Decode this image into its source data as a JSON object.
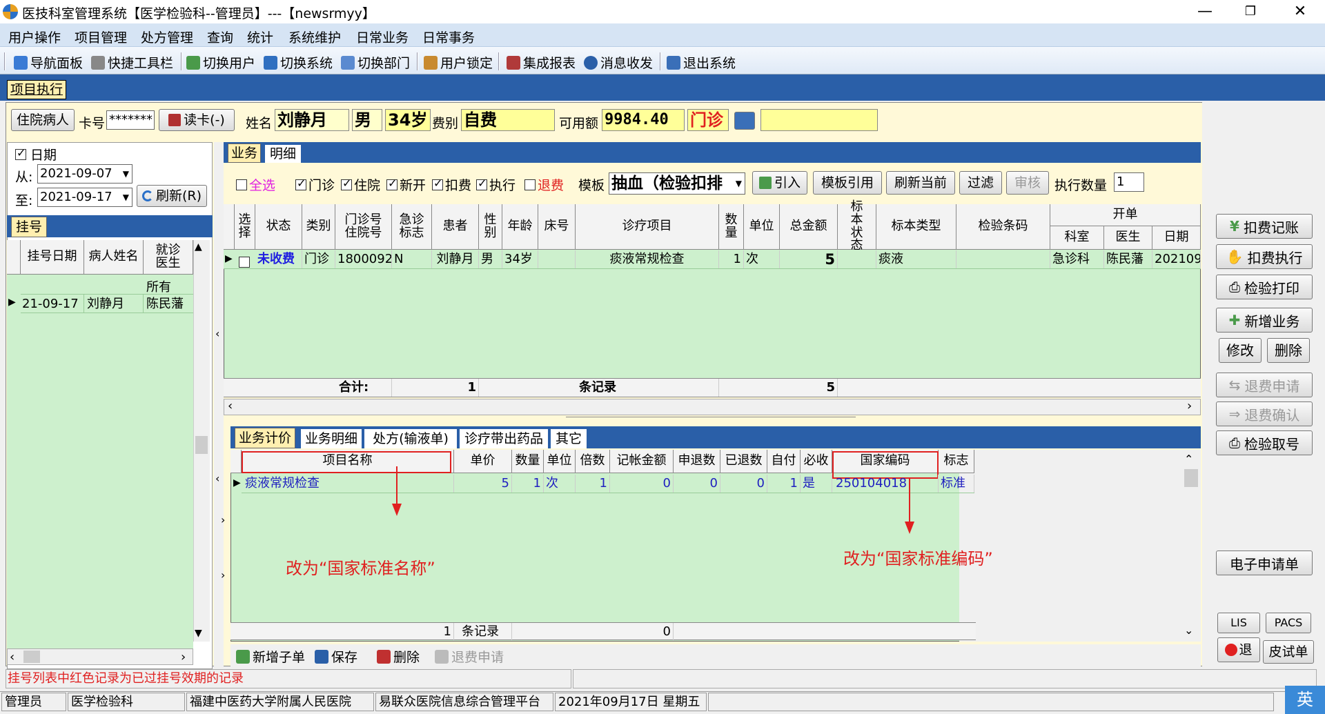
{
  "window": {
    "title": "医技科室管理系统【医学检验科--管理员】---【newsrmyy】",
    "min": "—",
    "restore": "❐",
    "close": "✕"
  },
  "menu": [
    "用户操作",
    "项目管理",
    "处方管理",
    "查询",
    "统计",
    "系统维护",
    "日常业务",
    "日常事务"
  ],
  "toolbar": [
    {
      "label": "导航面板",
      "icon": "dashboard-icon"
    },
    {
      "label": "快捷工具栏",
      "icon": "tools-icon"
    },
    {
      "label": "切换用户",
      "icon": "switch-user-icon"
    },
    {
      "label": "切换系统",
      "icon": "switch-system-icon"
    },
    {
      "label": "切换部门",
      "icon": "switch-dept-icon"
    },
    {
      "label": "用户锁定",
      "icon": "lock-user-icon"
    },
    {
      "label": "集成报表",
      "icon": "report-icon"
    },
    {
      "label": "消息收发",
      "icon": "message-icon"
    },
    {
      "label": "退出系统",
      "icon": "exit-icon"
    }
  ],
  "doc_tab": "项目执行",
  "patient": {
    "inpatient_btn": "住院病人",
    "card_label": "卡号",
    "card_value": "*******",
    "read_card_btn": "读卡(-)",
    "name_label": "姓名",
    "name": "刘静月",
    "sex": "男",
    "age": "34岁",
    "fee_label": "费别",
    "fee": "自费",
    "balance_label": "可用额",
    "balance": "9984.40",
    "visit_type": "门诊"
  },
  "left": {
    "date_label": "日期",
    "from_label": "从:",
    "from": "2021-09-07",
    "to_label": "至:",
    "to": "2021-09-17",
    "refresh_btn": "刷新(R)",
    "reg_tab": "挂号",
    "cols": [
      "挂号日期",
      "病人姓名",
      "就诊医生"
    ],
    "all_label": "所有",
    "rows": [
      {
        "date": "21-09-17",
        "name": "刘静月",
        "doctor": "陈民藩"
      }
    ]
  },
  "biz": {
    "tabs": [
      "业务",
      "明细"
    ],
    "filters": [
      {
        "label": "全选",
        "checked": false,
        "color": "#e020e0"
      },
      {
        "label": "门诊",
        "checked": true
      },
      {
        "label": "住院",
        "checked": true
      },
      {
        "label": "新开",
        "checked": true
      },
      {
        "label": "扣费",
        "checked": true
      },
      {
        "label": "执行",
        "checked": true
      },
      {
        "label": "退费",
        "checked": false,
        "color": "#e02020"
      }
    ],
    "template_label": "模板",
    "template_value": "抽血（检验扣排",
    "buttons": [
      "引入",
      "模板引用",
      "刷新当前",
      "过滤",
      "审核"
    ],
    "exec_qty_label": "执行数量",
    "exec_qty": "1",
    "cols": [
      "选择",
      "状态",
      "类别",
      "门诊号住院号",
      "急诊标志",
      "患者",
      "性别",
      "年龄",
      "床号",
      "诊疗项目",
      "数量",
      "单位",
      "总金额",
      "标本状态",
      "标本类型",
      "检验条码"
    ],
    "group_label": "开单",
    "group_cols": [
      "科室",
      "医生",
      "日期"
    ],
    "row": {
      "status": "未收费",
      "category": "门诊",
      "visit_no": "1800092",
      "emergency": "N",
      "patient": "刘静月",
      "sex": "男",
      "age": "34岁",
      "bed": "",
      "item": "痰液常规检查",
      "qty": "1",
      "unit": "次",
      "total": "5",
      "sample_status": "",
      "sample_type": "痰液",
      "barcode": "",
      "dept": "急诊科",
      "doctor": "陈民藩",
      "date": "202109"
    },
    "footer": {
      "sum_label": "合计:",
      "count": "1",
      "records_label": "条记录",
      "total": "5"
    }
  },
  "detail": {
    "tabs": [
      "业务计价",
      "业务明细",
      "处方(输液单)",
      "诊疗带出药品",
      "其它"
    ],
    "cols": [
      "项目名称",
      "单价",
      "数量",
      "单位",
      "倍数",
      "记帐金额",
      "申退数",
      "已退数",
      "自付",
      "必收",
      "国家编码",
      "标志"
    ],
    "row": {
      "name": "痰液常规检查",
      "price": "5",
      "qty": "1",
      "unit": "次",
      "multiple": "1",
      "amount": "0",
      "req_refund": "0",
      "refunded": "0",
      "self_pay": "1",
      "required": "是",
      "national_code": "250104018",
      "flag": "标准"
    },
    "footer": {
      "count": "1",
      "records_label": "条记录",
      "amount": "0"
    },
    "annot_name": "改为“国家标准名称”",
    "annot_code": "改为“国家标准编码”",
    "actions": [
      "新增子单",
      "保存",
      "删除",
      "退费申请"
    ]
  },
  "right_buttons": [
    {
      "label": "扣费记账",
      "icon": "yuan-icon",
      "enabled": true
    },
    {
      "label": "扣费执行",
      "icon": "hand-icon",
      "enabled": true
    },
    {
      "label": "检验打印",
      "icon": "printer-icon",
      "enabled": true
    },
    {
      "label": "新增业务",
      "icon": "add-doc-icon",
      "enabled": true
    },
    {
      "label": "修改",
      "icon": "",
      "enabled": true
    },
    {
      "label": "删除",
      "icon": "",
      "enabled": true
    },
    {
      "label": "退费申请",
      "icon": "refund-icon",
      "enabled": false
    },
    {
      "label": "退费确认",
      "icon": "confirm-icon",
      "enabled": false
    },
    {
      "label": "检验取号",
      "icon": "printer-icon",
      "enabled": true
    },
    {
      "label": "电子申请单",
      "icon": "",
      "enabled": true
    },
    {
      "label": "LIS",
      "icon": "",
      "enabled": true
    },
    {
      "label": "PACS",
      "icon": "",
      "enabled": true
    },
    {
      "label": "退",
      "icon": "power-icon",
      "enabled": true
    },
    {
      "label": "皮试单",
      "icon": "",
      "enabled": true
    }
  ],
  "status_hint": "挂号列表中红色记录为已过挂号效期的记录",
  "statusbar": [
    "管理员",
    "医学检验科",
    "福建中医药大学附属人民医院",
    "易联众医院信息综合管理平台",
    "2021年09月17日 星期五"
  ],
  "ime": "英",
  "colors": {
    "grid_bg": "#cdf0cd",
    "workarea_bg": "#fff9d8",
    "yellow_field": "#ffff99",
    "accent_blue": "#2a5fa8",
    "annotation_red": "#e02020"
  }
}
